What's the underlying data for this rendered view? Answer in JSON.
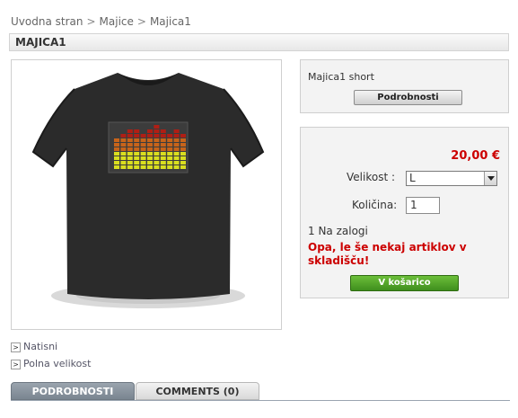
{
  "breadcrumb": {
    "home": "Uvodna stran",
    "sep1": ">",
    "category": "Majice",
    "sep2": ">",
    "current": "Majica1"
  },
  "product": {
    "title": "MAJICA1",
    "short_description": "Majica1 short",
    "details_button": "Podrobnosti"
  },
  "purchase": {
    "price": "20,00 €",
    "size_label": "Velikost :",
    "size_selected": "L",
    "quantity_label": "Količina:",
    "quantity_value": "1",
    "stock_text": "1 Na zalogi",
    "stock_warning": "Opa, le še nekaj artiklov v skladišču!",
    "add_to_cart": "V košarico"
  },
  "links": {
    "print": "Natisni",
    "full_size": "Polna velikost"
  },
  "tabs": [
    {
      "label": "PODROBNOSTI",
      "active": true
    },
    {
      "label": "COMMENTS (0)",
      "active": false
    }
  ],
  "icons": {
    "link_arrow": ">",
    "select_arrow": "chevron-down-icon"
  },
  "colors": {
    "price": "#cc0000",
    "cart_button": "#4f9f27",
    "tab_active": "#8a939c"
  }
}
